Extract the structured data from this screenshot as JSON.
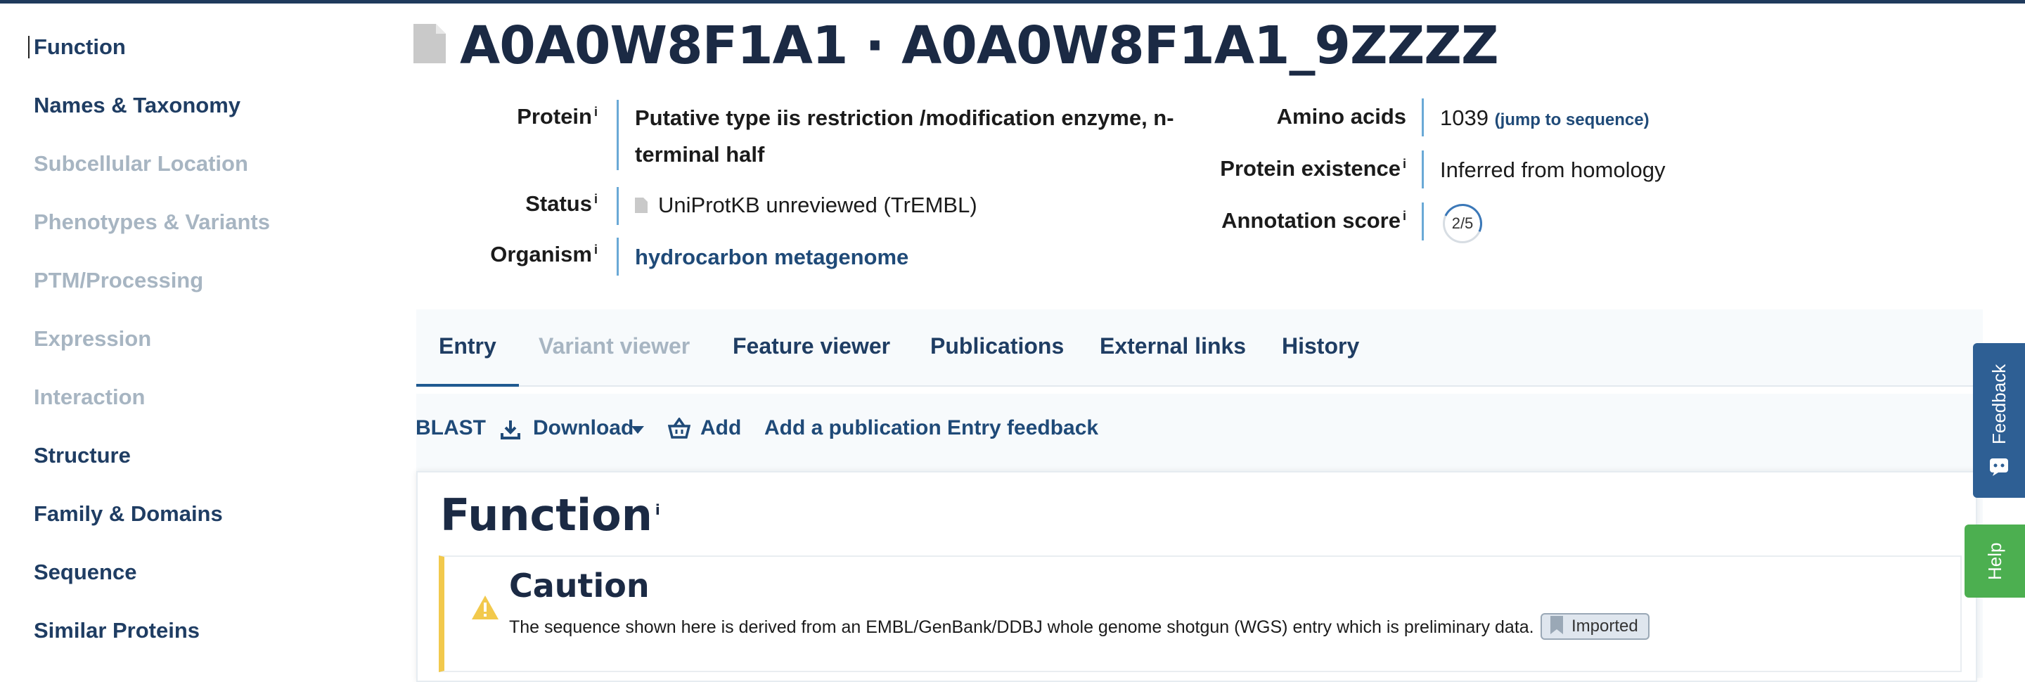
{
  "sidebar": {
    "items": [
      {
        "label": "Function"
      },
      {
        "label": "Names & Taxonomy"
      },
      {
        "label": "Subcellular Location"
      },
      {
        "label": "Phenotypes & Variants"
      },
      {
        "label": "PTM/Processing"
      },
      {
        "label": "Expression"
      },
      {
        "label": "Interaction"
      },
      {
        "label": "Structure"
      },
      {
        "label": "Family & Domains"
      },
      {
        "label": "Sequence"
      },
      {
        "label": "Similar Proteins"
      }
    ]
  },
  "header": {
    "title": "A0A0W8F1A1 · A0A0W8F1A1_9ZZZZ",
    "info_marker": "i",
    "protein_label": "Protein",
    "protein_value_line1": "Putative type iis restriction /modification enzyme, n-",
    "protein_value_line2": "terminal half",
    "status_label": "Status",
    "status_value": "UniProtKB unreviewed (TrEMBL)",
    "organism_label": "Organism",
    "organism_value": "hydrocarbon metagenome",
    "amino_acids_label": "Amino acids",
    "amino_acids_value": "1039",
    "jump_link": "(jump to sequence)",
    "existence_label": "Protein existence",
    "existence_value": "Inferred from homology",
    "annotation_label": "Annotation score",
    "annotation_value": "2/5"
  },
  "tabs": [
    {
      "label": "Entry"
    },
    {
      "label": "Variant viewer"
    },
    {
      "label": "Feature viewer"
    },
    {
      "label": "Publications"
    },
    {
      "label": "External links"
    },
    {
      "label": "History"
    }
  ],
  "toolbar": {
    "blast": "BLAST",
    "download": "Download",
    "add": "Add",
    "add_publication": "Add a publication",
    "entry_feedback": "Entry feedback"
  },
  "section": {
    "title": "Function",
    "caution_title": "Caution",
    "caution_text": "The sequence shown here is derived from an EMBL/GenBank/DDBJ whole genome shotgun (WGS) entry which is preliminary data.",
    "badge": "Imported"
  },
  "side_buttons": {
    "feedback": "Feedback",
    "help": "Help"
  },
  "colors": {
    "link": "#1f4a78",
    "disabled": "#a7b5c2",
    "caution_accent": "#f2c94c",
    "feedback_bg": "#2e5f94",
    "help_bg": "#4caf50"
  }
}
